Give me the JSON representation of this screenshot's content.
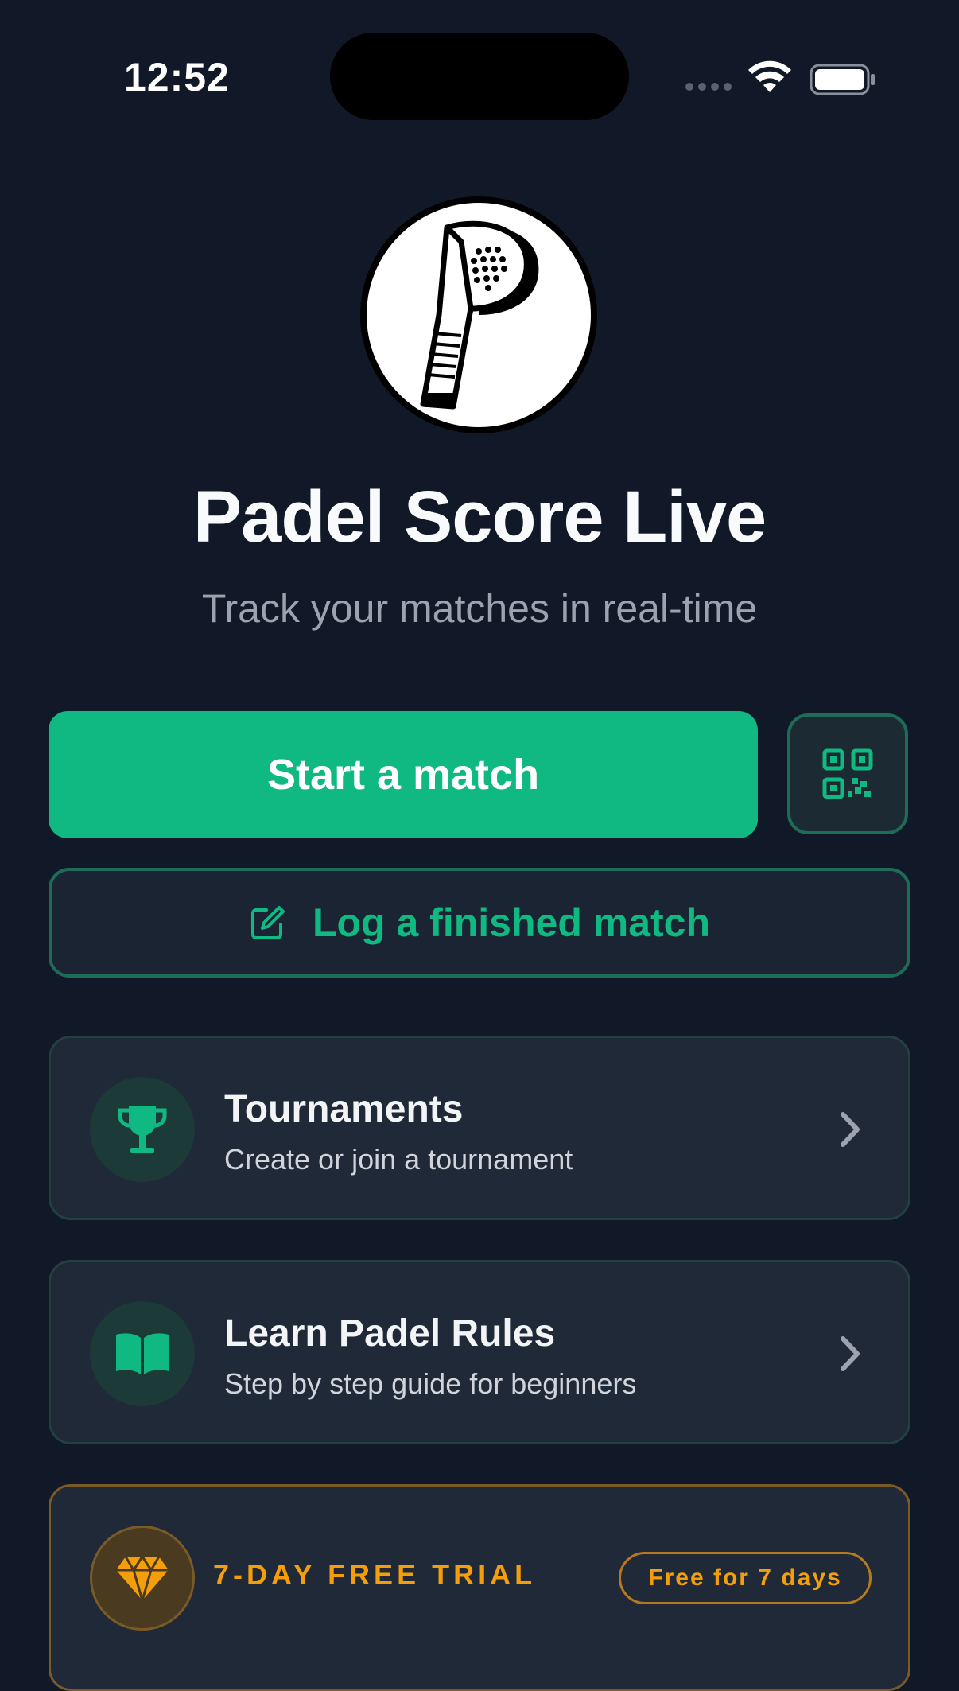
{
  "status_bar": {
    "time": "12:52",
    "icons": [
      "cellular-dots-icon",
      "wifi-icon",
      "battery-icon"
    ]
  },
  "app": {
    "logo": "padel-racket-logo",
    "title": "Padel Score Live",
    "subtitle": "Track your matches in real-time"
  },
  "actions": {
    "start_label": "Start a match",
    "qr_icon": "qr-code-icon",
    "log_label": "Log a finished match",
    "log_icon": "edit-icon"
  },
  "cards": [
    {
      "icon": "trophy-icon",
      "title": "Tournaments",
      "description": "Create or join a tournament"
    },
    {
      "icon": "book-icon",
      "title": "Learn Padel Rules",
      "description": "Step by step guide for beginners"
    }
  ],
  "trial": {
    "icon": "diamond-icon",
    "title": "7-DAY FREE TRIAL",
    "badge": "Free for 7 days"
  },
  "colors": {
    "background": "#111827",
    "accent": "#10b981",
    "card": "#1f2937",
    "trial": "#f59e0b",
    "subtitle": "#9ca3af"
  }
}
